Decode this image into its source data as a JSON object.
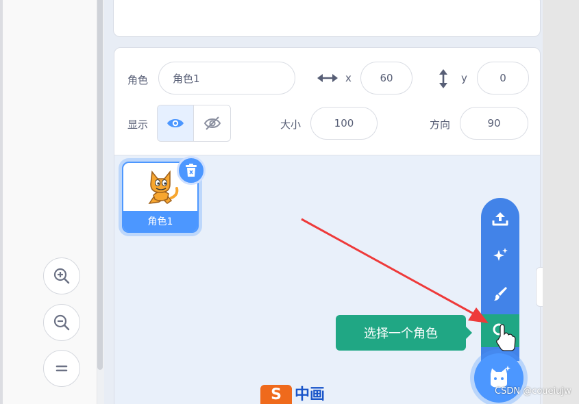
{
  "sprite_info": {
    "sprite_label": "角色",
    "sprite_name": "角色1",
    "x_label": "x",
    "x_value": "60",
    "y_label": "y",
    "y_value": "0",
    "show_label": "显示",
    "size_label": "大小",
    "size_value": "100",
    "direction_label": "方向",
    "direction_value": "90"
  },
  "sprite_list": [
    {
      "name": "角色1",
      "selected": true
    }
  ],
  "sprite_menu": {
    "items": [
      "upload-icon",
      "surprise-icon",
      "paint-icon",
      "search-icon"
    ],
    "tooltip": "选择一个角色"
  },
  "bottom_logo": {
    "mark": "S",
    "text": "中画"
  },
  "watermark": "CSDN @coueiujw",
  "colors": {
    "accent": "#4c97ff",
    "menu": "#4283e8",
    "active": "#20a784",
    "arrow": "#ee3a3a"
  }
}
